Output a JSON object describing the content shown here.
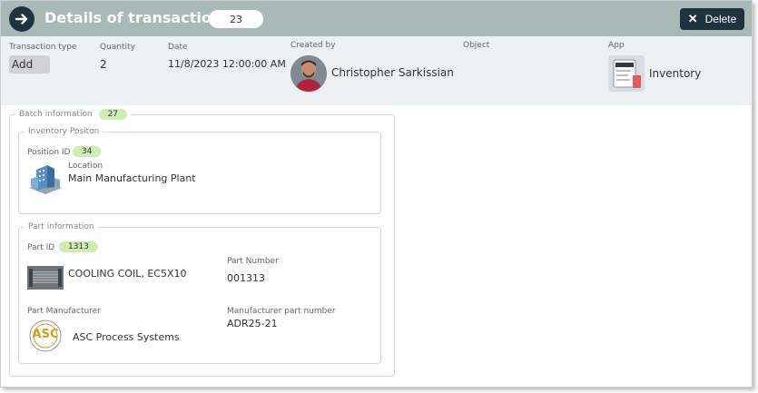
{
  "header": {
    "title": "Details of transaction",
    "count": "23",
    "delete_label": "Delete"
  },
  "summary": {
    "transaction_type": {
      "label": "Transaction type",
      "value": "Add"
    },
    "quantity": {
      "label": "Quantity",
      "value": "2"
    },
    "date": {
      "label": "Date",
      "value": "11/8/2023 12:00:00 AM"
    },
    "created_by": {
      "label": "Created by",
      "value": "Christopher Sarkissian"
    },
    "object": {
      "label": "Object",
      "value": ""
    },
    "app": {
      "label": "App",
      "value": "Inventory"
    }
  },
  "batch": {
    "label": "Batch information",
    "count": "27",
    "inventory_position": {
      "label": "Inventory Positon",
      "position_id_label": "Position ID",
      "position_id": "34",
      "location_label": "Location",
      "location": "Main Manufacturing Plant"
    },
    "part": {
      "label": "Part information",
      "part_id_label": "Part ID",
      "part_id": "1313",
      "name": "COOLING COIL, EC5X10",
      "part_number_label": "Part Number",
      "part_number": "001313",
      "manufacturer_label": "Part Manufacturer",
      "manufacturer": "ASC Process Systems",
      "manufacturer_logo_text": "ASC",
      "manufacturer_pn_label": "Manufacturer part number",
      "manufacturer_pn": "ADR25-21"
    }
  },
  "colors": {
    "header_bg": "#a9b9b5",
    "dark_button": "#1e3240",
    "summary_bg": "#ecf2f4",
    "badge_green": "#cdeeb0"
  },
  "icons": {
    "back": "arrow-right-icon",
    "delete": "close-icon",
    "location": "building-icon"
  }
}
